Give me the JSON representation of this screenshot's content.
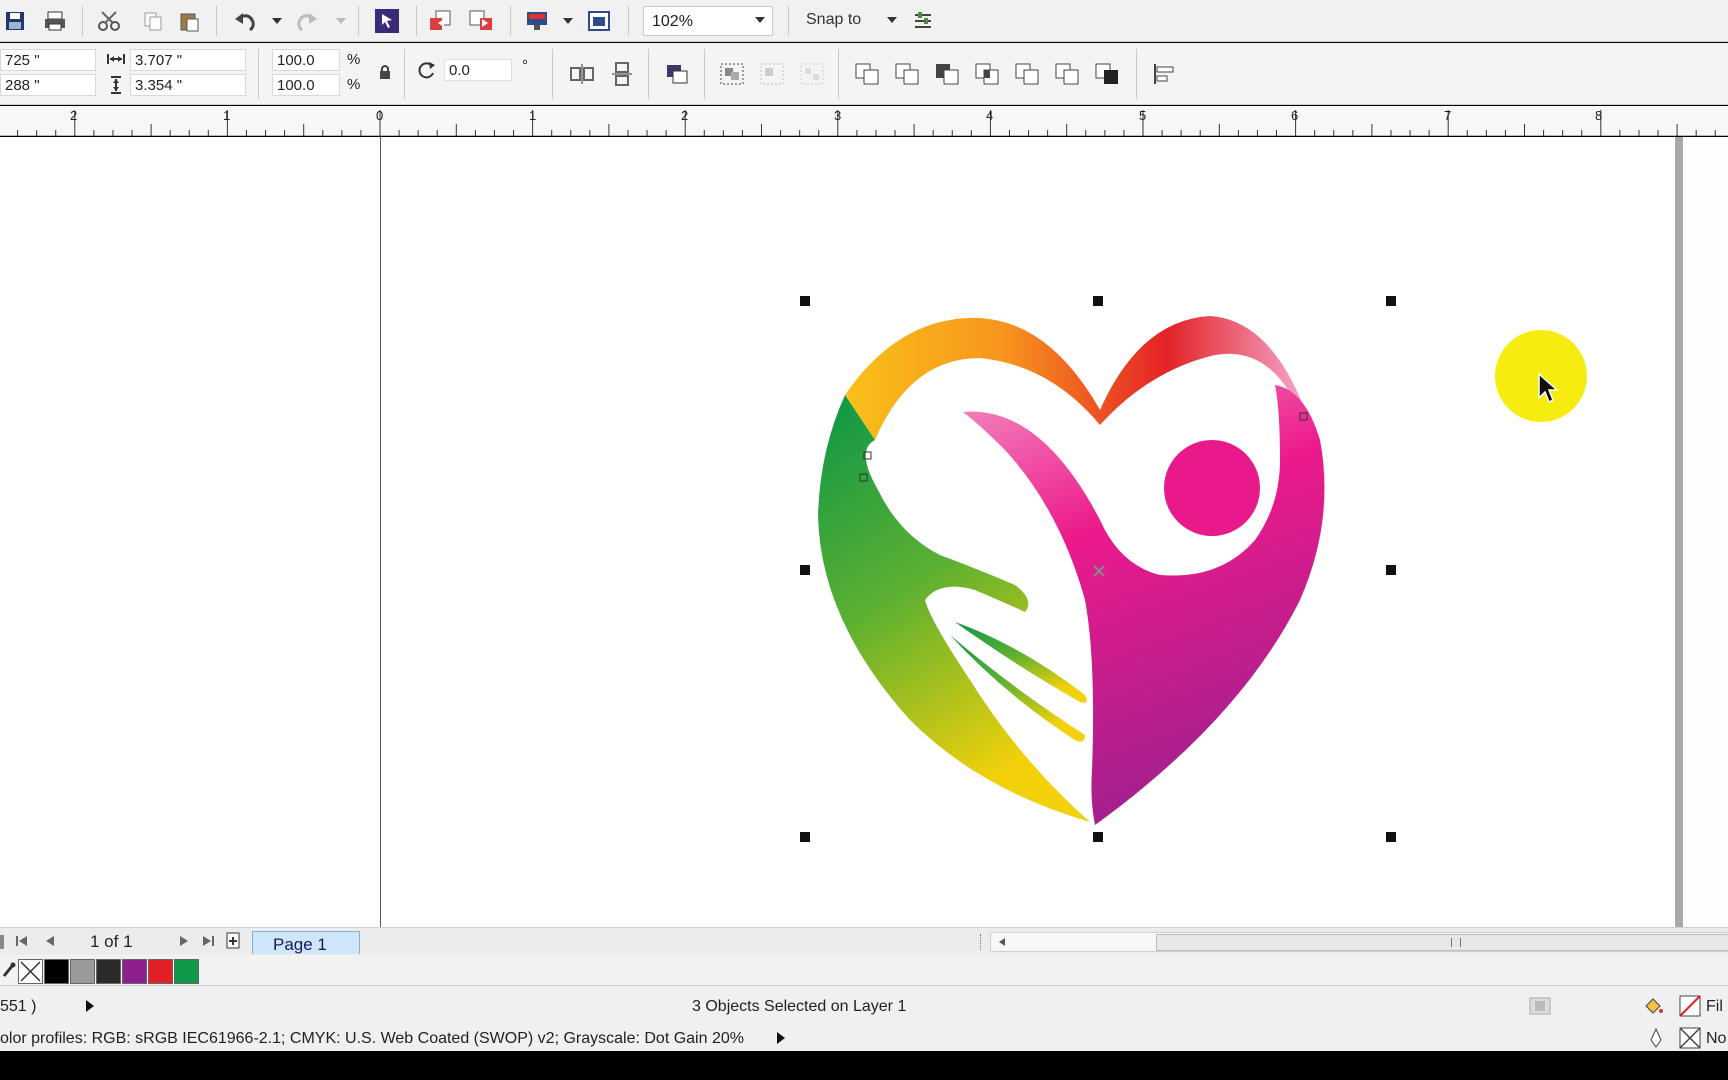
{
  "toolbar": {
    "zoom_level": "102%",
    "snap_to_label": "Snap to"
  },
  "property_bar": {
    "x_position": "725 \"",
    "y_position": "288 \"",
    "width": "3.707 \"",
    "height": "3.354 \"",
    "scale_x": "100.0",
    "scale_y": "100.0",
    "percent_symbol": "%",
    "rotation": "0.0",
    "degree_symbol": "°"
  },
  "ruler": {
    "ticks": [
      "2",
      "1",
      "0",
      "1",
      "2",
      "3",
      "4",
      "5",
      "6",
      "7",
      "8"
    ]
  },
  "page_nav": {
    "page_count": "1 of 1",
    "page_tab": "Page 1"
  },
  "palette": {
    "colors": [
      "#000000",
      "#9a9a9a",
      "#2a2a2a",
      "#8e1f8e",
      "#e32026",
      "#0f9a4a"
    ]
  },
  "status": {
    "cursor_coords": "551 )",
    "selection_info": "3 Objects Selected on Layer 1",
    "color_profiles": "olor profiles: RGB: sRGB IEC61966-2.1; CMYK: U.S. Web Coated (SWOP) v2; Grayscale: Dot Gain 20%",
    "fill_label": "Fil",
    "outline_label": "No"
  },
  "colors": {
    "cursor_highlight": "#f6ec10",
    "logo_magenta": "#e8198b",
    "logo_green": "#119a4c",
    "logo_orange": "#f7941d",
    "logo_red": "#e42227"
  }
}
